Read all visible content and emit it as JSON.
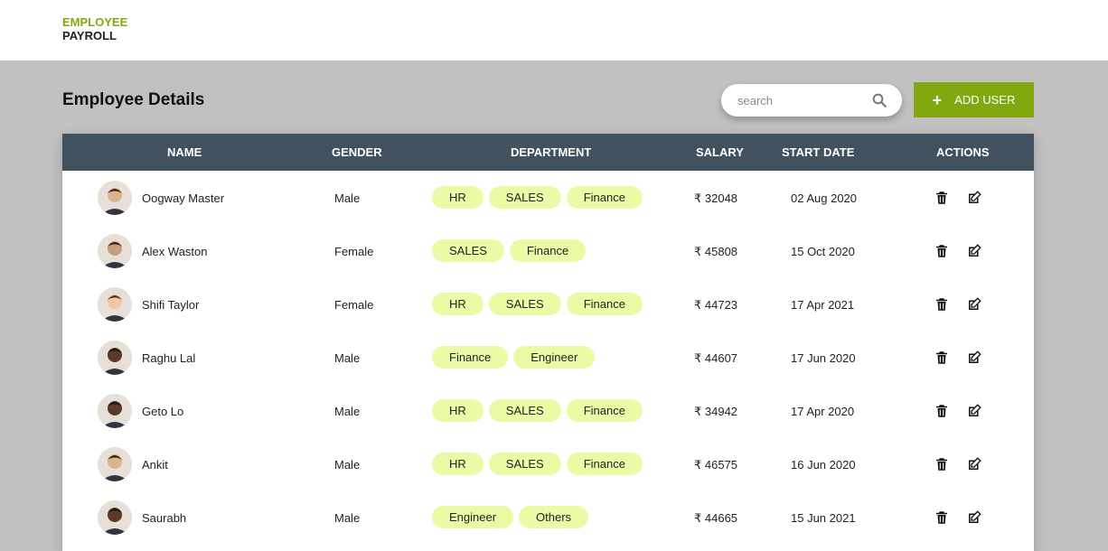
{
  "brand": {
    "line1": "EMPLOYEE",
    "line2": "PAYROLL"
  },
  "page_title": "Employee Details",
  "search": {
    "placeholder": "search"
  },
  "add_button": {
    "icon": "+",
    "label": "ADD USER"
  },
  "colors": {
    "accent": "#82a80f",
    "header_bg": "#42515f",
    "chip_bg": "#e9fca5",
    "page_bg": "#c1c1c1"
  },
  "table": {
    "headers": {
      "name": "NAME",
      "gender": "GENDER",
      "department": "DEPARTMENT",
      "salary": "SALARY",
      "start_date": "START DATE",
      "actions": "ACTIONS"
    },
    "rows": [
      {
        "name": "Oogway Master",
        "gender": "Male",
        "departments": [
          "HR",
          "SALES",
          "Finance"
        ],
        "salary": "₹ 32048",
        "start_date": "02 Aug 2020"
      },
      {
        "name": "Alex Waston",
        "gender": "Female",
        "departments": [
          "SALES",
          "Finance"
        ],
        "salary": "₹ 45808",
        "start_date": "15 Oct 2020"
      },
      {
        "name": "Shifi Taylor",
        "gender": "Female",
        "departments": [
          "HR",
          "SALES",
          "Finance"
        ],
        "salary": "₹ 44723",
        "start_date": "17 Apr 2021"
      },
      {
        "name": "Raghu Lal",
        "gender": "Male",
        "departments": [
          "Finance",
          "Engineer"
        ],
        "salary": "₹ 44607",
        "start_date": "17 Jun 2020"
      },
      {
        "name": "Geto Lo",
        "gender": "Male",
        "departments": [
          "HR",
          "SALES",
          "Finance"
        ],
        "salary": "₹ 34942",
        "start_date": "17 Apr 2020"
      },
      {
        "name": "Ankit",
        "gender": "Male",
        "departments": [
          "HR",
          "SALES",
          "Finance"
        ],
        "salary": "₹ 46575",
        "start_date": "16 Jun 2020"
      },
      {
        "name": "Saurabh",
        "gender": "Male",
        "departments": [
          "Engineer",
          "Others"
        ],
        "salary": "₹ 44665",
        "start_date": "15 Jun 2021"
      }
    ]
  }
}
